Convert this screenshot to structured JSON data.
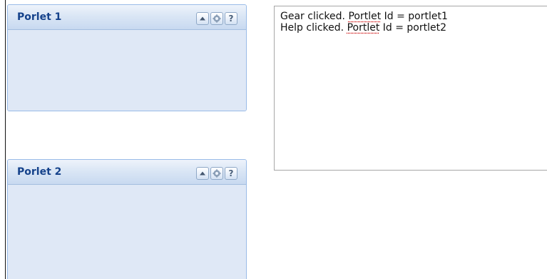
{
  "portlets": [
    {
      "title": "Porlet 1",
      "tools": [
        "collapse-icon",
        "gear-icon",
        "help-icon"
      ],
      "help_glyph": "?"
    },
    {
      "title": "Porlet 2",
      "tools": [
        "collapse-icon",
        "gear-icon",
        "help-icon"
      ],
      "help_glyph": "?"
    }
  ],
  "log": {
    "lines": [
      {
        "before": "Gear clicked. ",
        "flagged": "Portlet",
        "after": " Id = portlet1"
      },
      {
        "before": "Help clicked. ",
        "flagged": "Portlet",
        "after": " Id = portlet2"
      }
    ]
  },
  "colors": {
    "portlet_title": "#15428b",
    "portlet_body": "#dfe8f6",
    "portlet_border": "#99bbe8",
    "spellcheck_underline": "#cc0000"
  }
}
